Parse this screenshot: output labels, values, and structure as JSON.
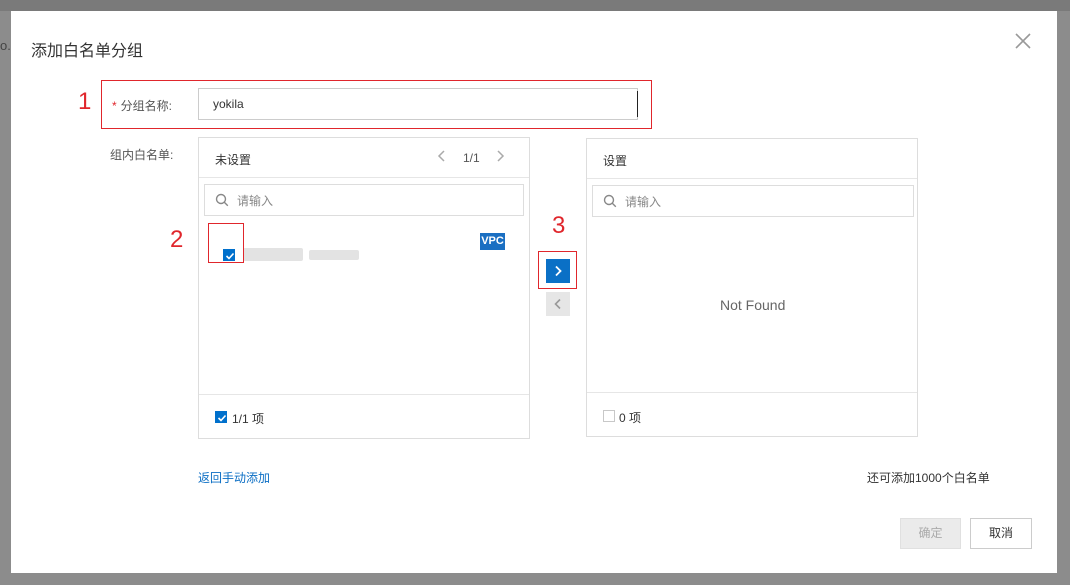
{
  "background": {
    "peek_text": "o."
  },
  "dialog": {
    "title": "添加白名单分组",
    "close_icon": "close-icon"
  },
  "annotations": [
    "1",
    "2",
    "3"
  ],
  "form": {
    "required_mark": "*",
    "group_name_label": "分组名称:",
    "group_name_value": "yokila",
    "members_label": "组内白名单:"
  },
  "left_panel": {
    "title": "未设置",
    "page": "1/1",
    "search_placeholder": "请输入",
    "items": [
      {
        "checked": true,
        "tag": "VPC"
      }
    ],
    "footer_count": "1/1 项",
    "footer_checked": true
  },
  "right_panel": {
    "title": "设置",
    "search_placeholder": "请输入",
    "empty_text": "Not Found",
    "footer_count": "0 项",
    "footer_checked": false
  },
  "links": {
    "back_manual": "返回手动添加"
  },
  "capacity_text": "还可添加1000个白名单",
  "buttons": {
    "confirm": "确定",
    "cancel": "取消"
  },
  "colors": {
    "accent": "#0070cc",
    "annotation": "#e0262c",
    "vpc_tag": "#1a6fc2"
  }
}
